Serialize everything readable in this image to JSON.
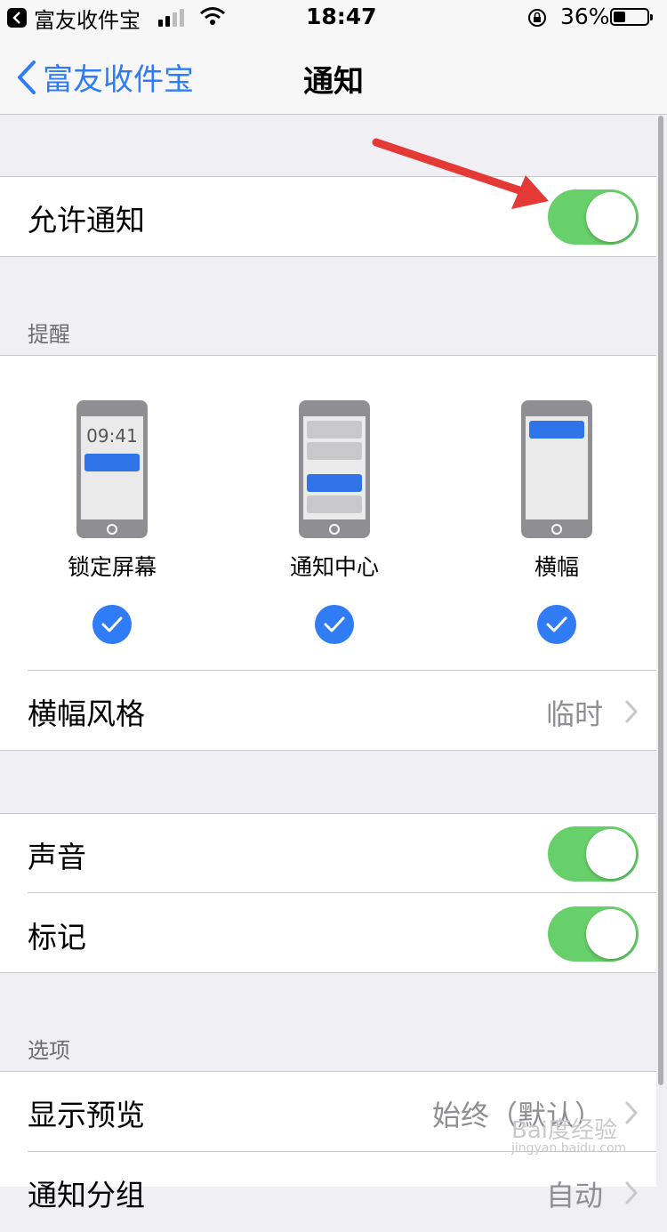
{
  "status_bar": {
    "app_back_label": "富友收件宝",
    "time": "18:47",
    "battery_percent": "36%"
  },
  "nav": {
    "back_label": "富友收件宝",
    "title": "通知"
  },
  "allow_notifications": {
    "label": "允许通知",
    "enabled": true
  },
  "alerts": {
    "header": "提醒",
    "styles": [
      {
        "label": "锁定屏幕",
        "preview_time": "09:41",
        "checked": true
      },
      {
        "label": "通知中心",
        "checked": true
      },
      {
        "label": "横幅",
        "checked": true
      }
    ],
    "banner_style": {
      "label": "横幅风格",
      "value": "临时"
    }
  },
  "sounds": {
    "label": "声音",
    "enabled": true
  },
  "badges": {
    "label": "标记",
    "enabled": true
  },
  "options": {
    "header": "选项",
    "show_previews": {
      "label": "显示预览",
      "value": "始终（默认）"
    },
    "grouping": {
      "label": "通知分组",
      "value": "自动"
    }
  },
  "colors": {
    "accent": "#2f7cf6",
    "toggle_on": "#67d06a",
    "annotation_arrow": "#e53935"
  },
  "watermark": {
    "text": "Bai度经验",
    "sub": "jingyan.baidu.com"
  }
}
